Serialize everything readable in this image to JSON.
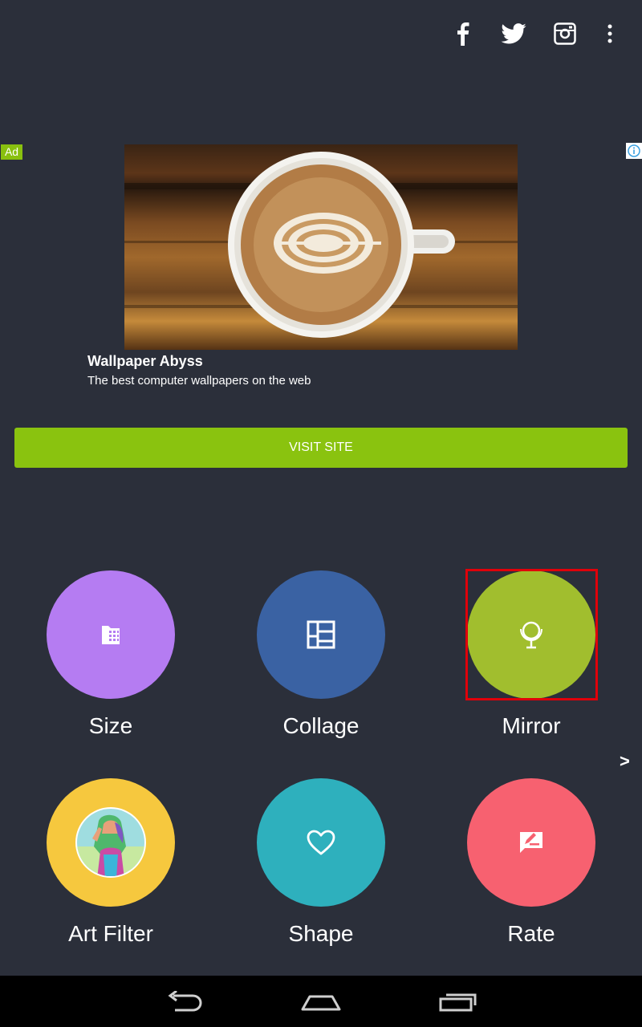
{
  "topbar": {
    "icons": [
      "facebook-icon",
      "twitter-icon",
      "instagram-icon",
      "overflow-menu-icon"
    ]
  },
  "ad": {
    "badge": "Ad",
    "title": "Wallpaper Abyss",
    "description": "The best computer wallpapers on the web",
    "cta_label": "VISIT SITE",
    "cta_color": "#8ac30f",
    "badge_color": "#89c00f"
  },
  "tiles": [
    {
      "label": "Size",
      "color": "#b57cf2",
      "icon": "size-icon"
    },
    {
      "label": "Collage",
      "color": "#3a62a3",
      "icon": "collage-icon"
    },
    {
      "label": "Mirror",
      "color": "#a1be2e",
      "icon": "mirror-icon"
    },
    {
      "label": "Art Filter",
      "color": "#f6c83e",
      "icon": "art-filter-thumbnail"
    },
    {
      "label": "Shape",
      "color": "#2eb0bd",
      "icon": "heart-icon"
    },
    {
      "label": "Rate",
      "color": "#f76170",
      "icon": "rate-icon"
    }
  ],
  "next_arrow": ">",
  "highlight_color": "#e0000a",
  "navbar": {
    "buttons": [
      "back-icon",
      "home-icon",
      "recents-icon"
    ]
  }
}
